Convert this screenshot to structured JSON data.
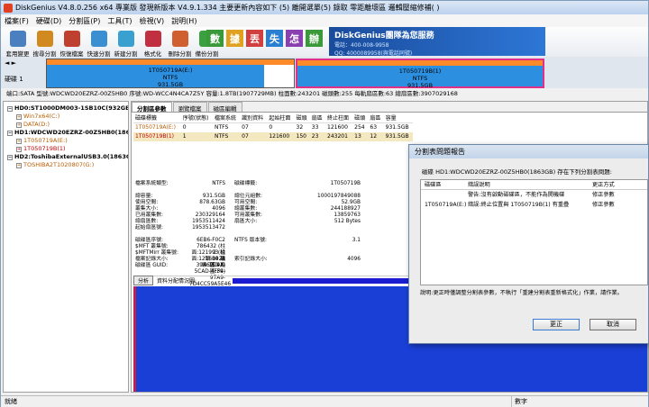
{
  "window": {
    "title": "DiskGenius V4.8.0.256 x64 專業版   發現新版本 V4.9.1.334 主要更新內容如下 (5) 離開選單(5)  錄取  零距離壞區  邏輯壓縮修補( )"
  },
  "menu": [
    "檔案(F)",
    "硬碟(D)",
    "分割區(P)",
    "工具(T)",
    "檢視(V)",
    "說明(H)"
  ],
  "toolbar": [
    {
      "label": "套用變更",
      "icon": "save-icon",
      "color": "#4a7fc0"
    },
    {
      "label": "搜尋分割",
      "icon": "search-icon",
      "color": "#d08a20"
    },
    {
      "label": "恢復檔案",
      "icon": "recover-icon",
      "color": "#c04030"
    },
    {
      "label": "快速分割",
      "icon": "quick-partition-icon",
      "color": "#3a8fd0"
    },
    {
      "label": "新建分割",
      "icon": "new-partition-icon",
      "color": "#3aa0d0"
    },
    {
      "label": "格式化",
      "icon": "format-icon",
      "color": "#c03040"
    },
    {
      "label": "刪除分割",
      "icon": "delete-partition-icon",
      "color": "#d06030"
    },
    {
      "label": "備份分割",
      "icon": "backup-partition-icon",
      "color": "#3aa040"
    }
  ],
  "banner": {
    "tiles": [
      "數",
      "據",
      "丟",
      "失",
      "怎",
      "辦"
    ],
    "brand": "DiskGenius團隊為您服務",
    "phone": "電話：400-008-9958",
    "qq": "QQ: 4000089958(與電話同號)"
  },
  "diskmap": {
    "disk_label": "硬碟 1",
    "partitions": [
      {
        "name": "1T050719A(E:)",
        "fs": "NTFS",
        "size": "931.5GB",
        "used": 0.88
      },
      {
        "name": "1T050719B(1)",
        "fs": "NTFS",
        "size": "931.5GB"
      }
    ]
  },
  "infobar": "端口:SATA  型號:WDCWD20EZRZ-00Z5HB0  序號:WD-WCC4N4CA7Z5Y  容量:1.8TB(1907729MB)  柱面數:243201  磁頭數:255  每軌扇區數:63  總扇區數:3907029168",
  "tree": [
    {
      "text": "HD0:ST1000DM003-1SB10C(932GB)",
      "level": 0,
      "expander": "−",
      "color": "black",
      "bold": true
    },
    {
      "text": "Win7x64(C:)",
      "level": 1,
      "expander": "+",
      "color": "orange"
    },
    {
      "text": "DATA(D:)",
      "level": 1,
      "expander": "+",
      "color": "orange"
    },
    {
      "text": "HD1:WDCWD20EZRZ-00Z5HB0(1863GB)",
      "level": 0,
      "expander": "−",
      "color": "black",
      "bold": true
    },
    {
      "text": "1T050719A(E:)",
      "level": 1,
      "expander": "+",
      "color": "orange"
    },
    {
      "text": "1T050719B(1)",
      "level": 1,
      "expander": "+",
      "color": "red"
    },
    {
      "text": "HD2:ToshibaExternalUSB3.0(1863GB)",
      "level": 0,
      "expander": "−",
      "color": "black",
      "bold": true
    },
    {
      "text": "TOSHIBA2T1020807(G:)",
      "level": 1,
      "expander": "+",
      "color": "orange"
    }
  ],
  "tabs": [
    "分割區參數",
    "瀏覽檔案",
    "磁區編輯"
  ],
  "partition_table": {
    "headers": [
      "磁碟標籤",
      "序號(狀態)",
      "檔案系統",
      "識別資料",
      "起始柱面",
      "磁頭",
      "扇區",
      "終止柱面",
      "磁頭",
      "扇區",
      "容量"
    ],
    "rows": [
      [
        "1T050719A(E:)",
        "0",
        "NTFS",
        "07",
        "0",
        "32",
        "33",
        "121600",
        "254",
        "63",
        "931.5GB"
      ],
      [
        "1T050719B(1)",
        "1",
        "NTFS",
        "07",
        "121600",
        "150",
        "23",
        "243201",
        "13",
        "12",
        "931.5GB"
      ]
    ]
  },
  "details": {
    "rows": [
      [
        "檔案系統類型:",
        "NTFS",
        "磁碟標籤:",
        "1T050719B"
      ],
      [
        "",
        "",
        "",
        ""
      ],
      [
        "總容量:",
        "931.5GB",
        "總位元組數:",
        "1000197849088"
      ],
      [
        "使用空間:",
        "878.63GB",
        "可用空間:",
        "52.9GB"
      ],
      [
        "叢集大小:",
        "4096",
        "總叢集數:",
        "244188927"
      ],
      [
        "已用叢集數:",
        "230329164",
        "可用叢集數:",
        "13859763"
      ],
      [
        "總扇區數:",
        "1953511424",
        "扇區大小:",
        "512 Bytes"
      ],
      [
        "起始扇區號:",
        "1953513472",
        "",
        ""
      ],
      [
        "",
        "",
        "",
        ""
      ],
      [
        "磁碟區序號:",
        "6EB6-F0C2",
        "NTFS 版本號:",
        "3.1"
      ],
      [
        "$MFT 叢集號:",
        "786432 (柱面:121993 磁頭:34 扇區:47)",
        "",
        ""
      ],
      [
        "$MFTMirr 叢集號:",
        "2 (柱面:121600 磁頭:150 扇區:39)",
        "",
        ""
      ],
      [
        "檔案記錄大小:",
        "1024",
        "索引記錄大小:",
        "4096"
      ],
      [
        "磁碟區 GUID:",
        "39A69C9A-5CAD-4FF4-97A9-7D4CC59A5E46",
        "",
        ""
      ]
    ]
  },
  "analyze": {
    "button": "分析",
    "label": "資料分配情況圖:",
    "legend": "已分"
  },
  "status": {
    "left": "就緒",
    "right": "數字"
  },
  "dialog": {
    "title": "分割表問題報告",
    "message": "磁碟 HD1:WDCWD20EZRZ-00Z5HB0(1863GB) 存在下列分割表問題:",
    "headers": [
      "磁碟區",
      "錯誤說明",
      "更正方式"
    ],
    "rows": [
      [
        "",
        "警告:沒有啟動磁碟區，不能作為開機碟",
        "修正參數"
      ],
      [
        "1T050719A(E:)",
        "錯誤:終止位置與 1T050719B(1) 有重疊",
        "修正參數"
      ]
    ],
    "note": "說明:更正時僅調整分割表參數，不執行「重建分割表重新格式化」作業，請作業。",
    "ok": "更正",
    "cancel": "取消"
  }
}
